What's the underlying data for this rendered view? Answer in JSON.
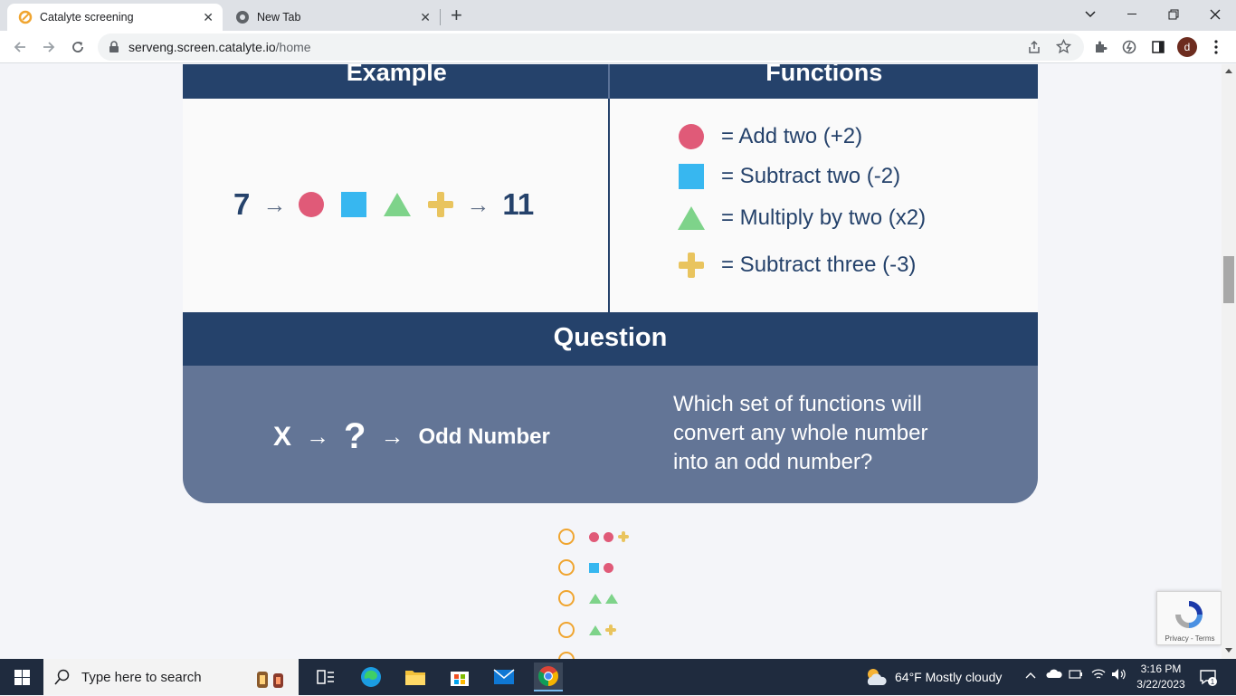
{
  "browser": {
    "tabs": [
      {
        "title": "Catalyte screening",
        "active": true
      },
      {
        "title": "New Tab",
        "active": false
      }
    ],
    "new_tab_label": "+",
    "url_host": "serveng.screen.catalyte.io",
    "url_path": "/home",
    "profile_initial": "d"
  },
  "page": {
    "example_header": "Example",
    "functions_header": "Functions",
    "example": {
      "start": "7",
      "arrow": "→",
      "shapes": [
        "circle",
        "square",
        "triangle",
        "plus"
      ],
      "result": "11"
    },
    "functions": [
      {
        "shape": "circle",
        "text": "= Add two (+2)"
      },
      {
        "shape": "square",
        "text": "= Subtract two (-2)"
      },
      {
        "shape": "triangle",
        "text": "= Multiply by two (x2)"
      },
      {
        "shape": "plus",
        "text": "= Subtract three (-3)"
      }
    ],
    "question_header": "Question",
    "question": {
      "input": "X",
      "arrow": "→",
      "unknown": "?",
      "output": "Odd Number",
      "prompt": "Which set of functions will convert any whole number into an odd number?"
    },
    "options": [
      {
        "shapes": [
          "circle",
          "circle",
          "plus"
        ]
      },
      {
        "shapes": [
          "square",
          "circle"
        ]
      },
      {
        "shapes": [
          "triangle",
          "triangle"
        ]
      },
      {
        "shapes": [
          "triangle",
          "plus"
        ]
      }
    ],
    "recaptcha_links": "Privacy - Terms"
  },
  "colors": {
    "navy": "#25426b",
    "slate": "#637596",
    "circle": "#e05a78",
    "square": "#37b7f0",
    "triangle": "#7ed38a",
    "plus": "#e9c45e",
    "radio": "#f0a530"
  },
  "taskbar": {
    "search_placeholder": "Type here to search",
    "weather": "64°F  Mostly cloudy",
    "time": "3:16 PM",
    "date": "3/22/2023",
    "notification_count": "1"
  }
}
